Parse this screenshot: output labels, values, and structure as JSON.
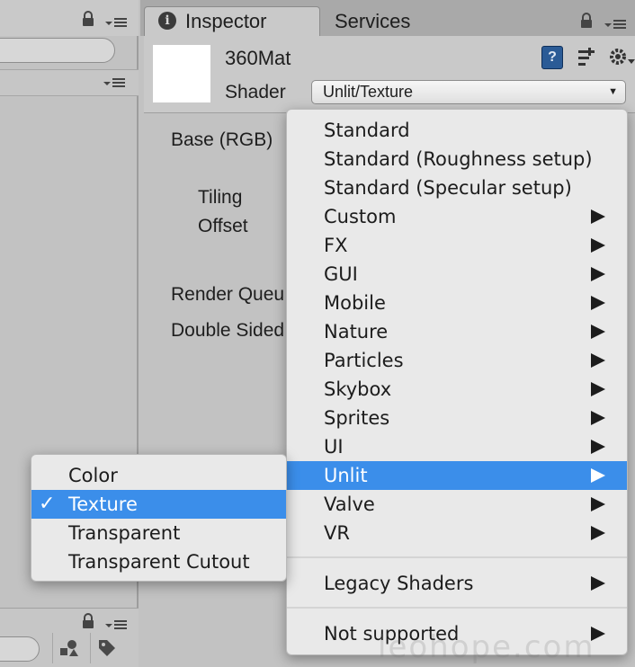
{
  "tabs": {
    "inspector": "Inspector",
    "services": "Services"
  },
  "material": {
    "name": "360Mat",
    "shader_label": "Shader",
    "shader_value": "Unlit/Texture"
  },
  "properties": {
    "base_rgb": "Base (RGB)",
    "tiling": "Tiling",
    "offset": "Offset",
    "render_queue": "Render Queu",
    "double_sided": "Double Sided"
  },
  "icons": {
    "lock": "lock-icon",
    "menu": "panel-menu-icon",
    "info": "info-icon",
    "book": "help-book-icon",
    "presets": "presets-icon",
    "gear": "gear-icon"
  },
  "shader_menu": {
    "items": [
      {
        "label": "Standard",
        "submenu": false
      },
      {
        "label": "Standard (Roughness setup)",
        "submenu": false
      },
      {
        "label": "Standard (Specular setup)",
        "submenu": false
      },
      {
        "label": "Custom",
        "submenu": true
      },
      {
        "label": "FX",
        "submenu": true
      },
      {
        "label": "GUI",
        "submenu": true
      },
      {
        "label": "Mobile",
        "submenu": true
      },
      {
        "label": "Nature",
        "submenu": true
      },
      {
        "label": "Particles",
        "submenu": true
      },
      {
        "label": "Skybox",
        "submenu": true
      },
      {
        "label": "Sprites",
        "submenu": true
      },
      {
        "label": "UI",
        "submenu": true
      },
      {
        "label": "Unlit",
        "submenu": true,
        "highlighted": true
      },
      {
        "label": "Valve",
        "submenu": true
      },
      {
        "label": "VR",
        "submenu": true
      },
      {
        "label": "Legacy Shaders",
        "submenu": true
      },
      {
        "label": "Not supported",
        "submenu": true
      }
    ]
  },
  "unlit_submenu": {
    "items": [
      {
        "label": "Color",
        "checked": false
      },
      {
        "label": "Texture",
        "checked": true
      },
      {
        "label": "Transparent",
        "checked": false
      },
      {
        "label": "Transparent Cutout",
        "checked": false
      }
    ],
    "check_glyph": "✓"
  },
  "watermark": "leohope.com",
  "colors": {
    "highlight": "#3b8eea",
    "menu_bg": "#e9e9e9",
    "panel_bg": "#c2c2c2"
  }
}
